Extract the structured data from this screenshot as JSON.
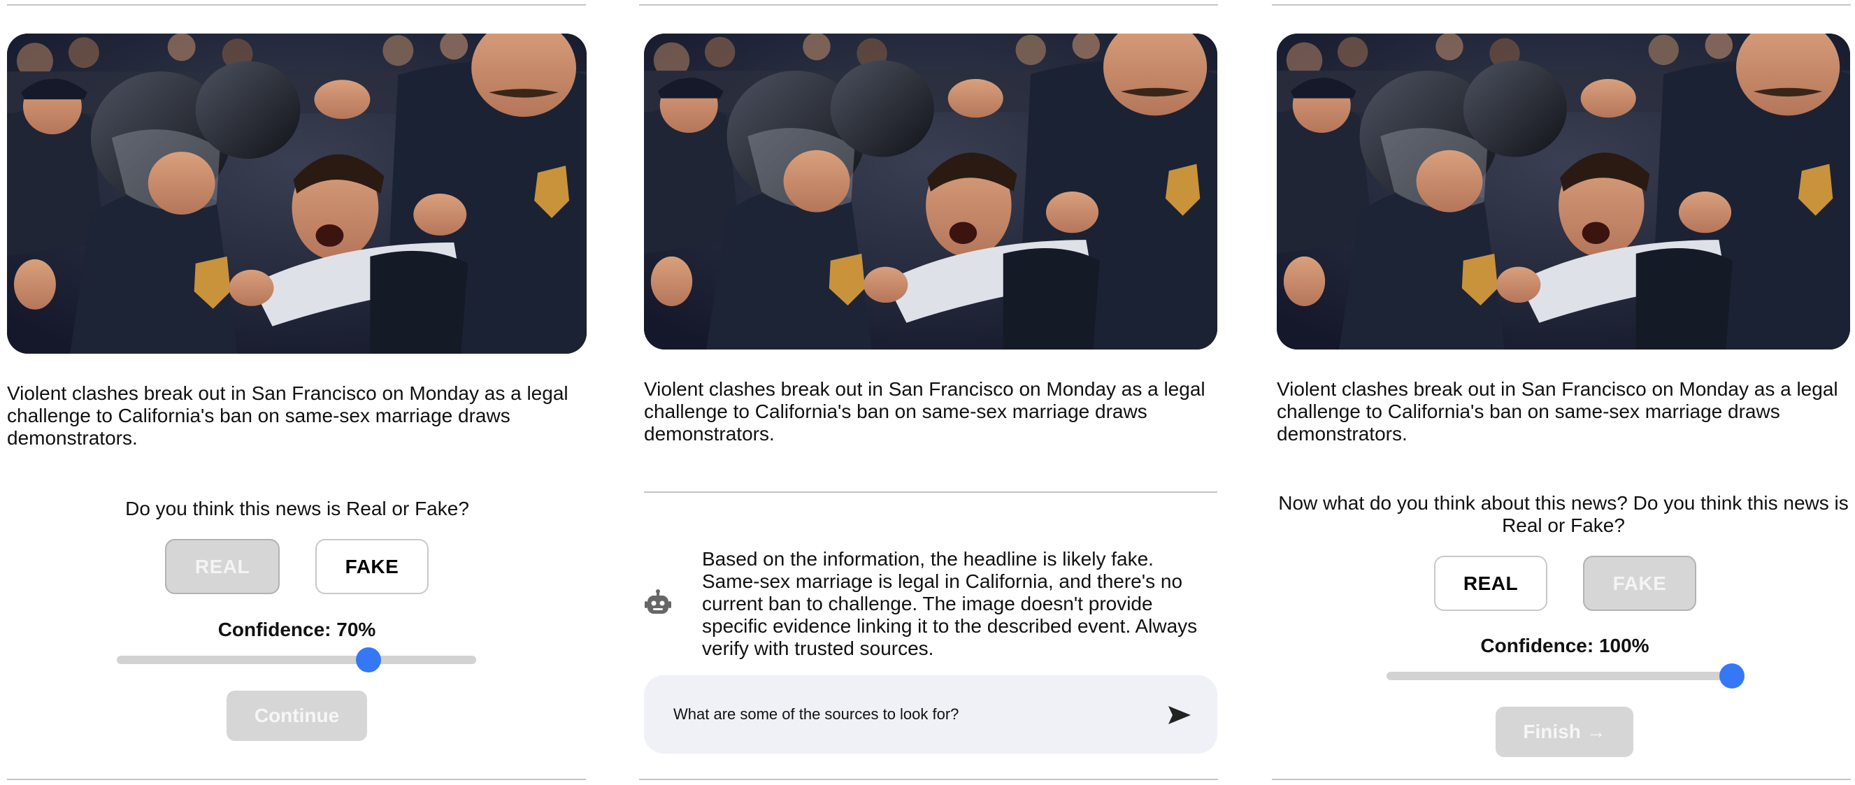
{
  "headline": "Violent clashes break out in San Francisco on Monday as a legal challenge to California's ban on same-sex marriage draws demonstrators.",
  "image_icon": "photo-protest-arrest",
  "panel1": {
    "question": "Do you think this news is Real or Fake?",
    "real_label": "REAL",
    "fake_label": "FAKE",
    "selected": "FAKE",
    "confidence_label": "Confidence: 70%",
    "confidence_value": 0.7,
    "continue_label": "Continue"
  },
  "panel2": {
    "assistant_icon": "robot-icon",
    "assistant_message": "Based on the information, the headline is likely fake. Same-sex marriage is legal in California, and there's no current ban to challenge. The image doesn't provide specific evidence linking it to the described event. Always verify with trusted sources.",
    "chat_input_value": "What are some of the sources to look for?",
    "send_icon": "send-icon"
  },
  "panel3": {
    "question": "Now what do you think about this news? Do you think this news is Real or Fake?",
    "real_label": "REAL",
    "fake_label": "FAKE",
    "selected": "REAL",
    "confidence_label": "Confidence: 100%",
    "confidence_value": 1.0,
    "finish_label": "Finish →"
  },
  "colors": {
    "accent": "#3478f6",
    "disabled_button": "#d6d6d6",
    "chat_background": "#f0f1f6",
    "divider": "#c4c4c4"
  }
}
